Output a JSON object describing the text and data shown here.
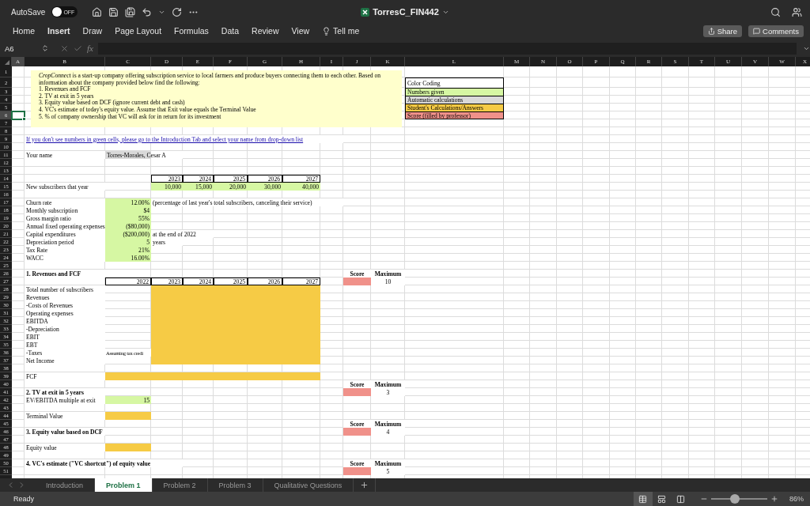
{
  "titlebar": {
    "autosave_label": "AutoSave",
    "autosave": {
      "on": false,
      "label": "OFF"
    },
    "title": "TorresC_FIN442"
  },
  "ribbon": {
    "tabs": [
      {
        "label": "Home",
        "selected": false
      },
      {
        "label": "Insert",
        "selected": true
      },
      {
        "label": "Draw",
        "selected": false
      },
      {
        "label": "Page Layout",
        "selected": false
      },
      {
        "label": "Formulas",
        "selected": false
      },
      {
        "label": "Data",
        "selected": false
      },
      {
        "label": "Review",
        "selected": false
      },
      {
        "label": "View",
        "selected": false
      }
    ],
    "tell_me": "Tell me",
    "share": "Share",
    "comments": "Comments"
  },
  "formula_bar": {
    "name_box": "A6",
    "fx": "fx"
  },
  "sheet": {
    "columns": [
      {
        "label": "A",
        "selected": true
      },
      {
        "label": "B",
        "selected": false
      },
      {
        "label": "C",
        "selected": false
      },
      {
        "label": "D",
        "selected": false
      },
      {
        "label": "E",
        "selected": false
      },
      {
        "label": "F",
        "selected": false
      },
      {
        "label": "G",
        "selected": false
      },
      {
        "label": "H",
        "selected": false
      },
      {
        "label": "I",
        "selected": false
      },
      {
        "label": "J",
        "selected": false
      },
      {
        "label": "K",
        "selected": false
      },
      {
        "label": "L",
        "selected": false
      },
      {
        "label": "M",
        "selected": false
      },
      {
        "label": "N",
        "selected": false
      },
      {
        "label": "O",
        "selected": false
      },
      {
        "label": "P",
        "selected": false
      },
      {
        "label": "Q",
        "selected": false
      },
      {
        "label": "R",
        "selected": false
      },
      {
        "label": "S",
        "selected": false
      },
      {
        "label": "T",
        "selected": false
      },
      {
        "label": "U",
        "selected": false
      },
      {
        "label": "V",
        "selected": false
      },
      {
        "label": "W",
        "selected": false
      },
      {
        "label": "X",
        "selected": false
      }
    ],
    "rows": [
      {
        "number": "1",
        "selected": false
      },
      {
        "number": "2",
        "selected": false
      },
      {
        "number": "3",
        "selected": false
      },
      {
        "number": "4",
        "selected": false
      },
      {
        "number": "5",
        "selected": false
      },
      {
        "number": "6",
        "selected": true
      },
      {
        "number": "7",
        "selected": false
      },
      {
        "number": "8",
        "selected": false
      },
      {
        "number": "9",
        "selected": false
      },
      {
        "number": "10",
        "selected": false
      },
      {
        "number": "11",
        "selected": false
      },
      {
        "number": "12",
        "selected": false
      },
      {
        "number": "13",
        "selected": false
      },
      {
        "number": "14",
        "selected": false
      },
      {
        "number": "15",
        "selected": false
      },
      {
        "number": "16",
        "selected": false
      },
      {
        "number": "17",
        "selected": false
      },
      {
        "number": "18",
        "selected": false
      },
      {
        "number": "19",
        "selected": false
      },
      {
        "number": "20",
        "selected": false
      },
      {
        "number": "21",
        "selected": false
      },
      {
        "number": "22",
        "selected": false
      },
      {
        "number": "23",
        "selected": false
      },
      {
        "number": "24",
        "selected": false
      },
      {
        "number": "25",
        "selected": false
      },
      {
        "number": "26",
        "selected": false
      },
      {
        "number": "27",
        "selected": false
      },
      {
        "number": "28",
        "selected": false
      },
      {
        "number": "29",
        "selected": false
      },
      {
        "number": "30",
        "selected": false
      },
      {
        "number": "31",
        "selected": false
      },
      {
        "number": "32",
        "selected": false
      },
      {
        "number": "33",
        "selected": false
      },
      {
        "number": "34",
        "selected": false
      },
      {
        "number": "35",
        "selected": false
      },
      {
        "number": "36",
        "selected": false
      },
      {
        "number": "37",
        "selected": false
      },
      {
        "number": "38",
        "selected": false
      },
      {
        "number": "39",
        "selected": false
      },
      {
        "number": "40",
        "selected": false
      },
      {
        "number": "41",
        "selected": false
      },
      {
        "number": "42",
        "selected": false
      },
      {
        "number": "43",
        "selected": false
      },
      {
        "number": "44",
        "selected": false
      },
      {
        "number": "45",
        "selected": false
      },
      {
        "number": "46",
        "selected": false
      },
      {
        "number": "47",
        "selected": false
      },
      {
        "number": "48",
        "selected": false
      },
      {
        "number": "49",
        "selected": false
      },
      {
        "number": "50",
        "selected": false
      },
      {
        "number": "51",
        "selected": false
      }
    ],
    "text_box": {
      "intro": "*CropConnect* is a start-up company offering subscription service to local farmers and produce buyers connecting them to each other. Based on information about the company provided below find the following:",
      "items": [
        "1. Revenues and FCF",
        "2. TV at exit in 5 years",
        "3. Equity value based on DCF (ignore current debt and cash)",
        "4. VC's estimate of today's equity value. Assume that Exit value equals the Terminal Value",
        "5. % of company ownership that VC will ask for in return for its investment"
      ]
    },
    "legend": {
      "title": "Color Coding",
      "items": [
        {
          "kind": "given",
          "text": "Numbers given",
          "color": "#d6f7a3"
        },
        {
          "kind": "auto",
          "text": "Automatic calculations",
          "color": "#d9d9d9"
        },
        {
          "kind": "student",
          "text": "Student's Calculations/Answers",
          "color": "#f6cb45"
        },
        {
          "kind": "score",
          "text": "Score (filled by professor)",
          "color": "#f0918a"
        }
      ]
    },
    "link": "If you don't see numbers in green cells, please go to the Introduction Tab and select your name from drop-down list",
    "your_name": {
      "label": "Your name",
      "value": "Torres-Morales, Cesar A",
      "kind": "auto"
    },
    "subscribers": {
      "years": [
        "2023",
        "2024",
        "2025",
        "2026",
        "2027"
      ],
      "label": "New subscribers that year",
      "values": [
        "10,000",
        "15,000",
        "20,000",
        "30,000",
        "40,000"
      ],
      "kind": "given"
    },
    "inputs": [
      {
        "label": "Churn rate",
        "value": "12.00%",
        "kind": "given",
        "note": "(percentage of last year's total subscribers, canceling their service)"
      },
      {
        "label": "Monthly subscription",
        "value": "$4",
        "kind": "given"
      },
      {
        "label": "Gross margin ratio",
        "value": "55%",
        "kind": "given"
      },
      {
        "label": "Annual fixed operating expenses",
        "value": "($80,000)",
        "kind": "given"
      },
      {
        "label": "Capital expenditures",
        "value": "($200,000)",
        "kind": "given",
        "note": "at the end of 2022"
      },
      {
        "label": "Depreciation period",
        "value": "5",
        "kind": "given",
        "note": "years"
      },
      {
        "label": "Tax Rate",
        "value": "21%",
        "kind": "given"
      },
      {
        "label": "WACC",
        "value": "16.00%",
        "kind": "given"
      }
    ],
    "revenues": {
      "title": "1. Revenues and FCF",
      "score": {
        "label": "Score",
        "max_label": "Maximum",
        "maximum": "10",
        "kind": "score"
      },
      "years": [
        "2022",
        "2023",
        "2024",
        "2025",
        "2026",
        "2027"
      ],
      "lines": [
        "Total number of subscribers",
        "Revenues",
        "-Costs of Revenues",
        "Operating expenses",
        "EBITDA",
        "-Depreciation",
        "EBIT",
        "EBT",
        "-Taxes",
        "Net Income"
      ],
      "note": "Assuming tax credi",
      "kind": "student",
      "fcf": {
        "label": "FCF",
        "kind": "student"
      }
    },
    "terminal_value": {
      "title": "2. TV at exit in 5 years",
      "score": {
        "label": "Score",
        "max_label": "Maximum",
        "maximum": "3",
        "kind": "score"
      },
      "multiple": {
        "label": "EV/EBITDA multiple at exit",
        "value": "15",
        "kind": "given"
      },
      "result": {
        "label": "Terminal Value",
        "kind": "student"
      }
    },
    "equity": {
      "title": "3. Equity value based on DCF",
      "score": {
        "label": "Score",
        "max_label": "Maximum",
        "maximum": "4",
        "kind": "score"
      },
      "result": {
        "label": "Equity value",
        "kind": "student"
      }
    },
    "vc_estimate": {
      "title": "4. VC's estimate (\"VC shortcut\") of equity value",
      "score": {
        "label": "Score",
        "max_label": "Maximum",
        "maximum": "5",
        "kind": "score"
      }
    }
  },
  "sheet_tabs": [
    {
      "label": "Introduction",
      "selected": false
    },
    {
      "label": "Problem 1",
      "selected": true
    },
    {
      "label": "Problem 2",
      "selected": false
    },
    {
      "label": "Problem 3",
      "selected": false
    },
    {
      "label": "Qualitative Questions",
      "selected": false
    }
  ],
  "status_bar": {
    "status": "Ready",
    "views": [
      {
        "kind": "normal",
        "selected": true
      },
      {
        "kind": "page_layout",
        "selected": false
      },
      {
        "kind": "page_break",
        "selected": false
      }
    ],
    "zoom": {
      "level": 0.42,
      "reading": "86%"
    }
  }
}
